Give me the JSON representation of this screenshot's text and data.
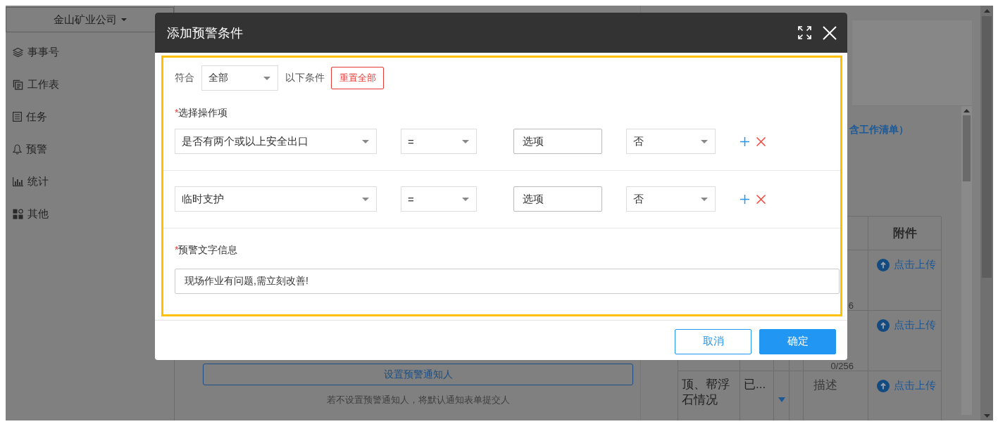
{
  "sidebar": {
    "company": "金山矿业公司",
    "items": [
      {
        "label": "事事号"
      },
      {
        "label": "工作表"
      },
      {
        "label": "任务"
      },
      {
        "label": "预警"
      },
      {
        "label": "统计"
      },
      {
        "label": "其他"
      }
    ]
  },
  "dialog": {
    "title": "添加预警条件",
    "highlighted": true,
    "match": {
      "label": "符合",
      "value": "全部",
      "suffix": "以下条件"
    },
    "reset_button": "重置全部",
    "conditions_label": {
      "mark": "*",
      "text": "选择操作项"
    },
    "conditions": [
      {
        "field": "是否有两个或以上安全出口",
        "operator": "=",
        "value": "选项",
        "answer": "否"
      },
      {
        "field": "临时支护",
        "operator": "=",
        "value": "选项",
        "answer": "否"
      }
    ],
    "message_label": {
      "mark": "*",
      "text": "预警文字信息"
    },
    "message": "现场作业有问题,需立刻改善!",
    "buttons": [
      {
        "label": "取消",
        "kind": "secondary"
      },
      {
        "label": "确定",
        "kind": "primary"
      }
    ]
  },
  "form": {
    "notify_button": "设置预警通知人",
    "hint": "若不设置预警通知人，将默认通知表单提交人"
  },
  "checklist": {
    "title": "含工作清单）",
    "table": {
      "columns": [
        {
          "label": "附件"
        }
      ],
      "rows": [
        {
          "counter": "6",
          "attachment": "点击上传"
        },
        {
          "counter": "0/256",
          "attachment": "点击上传"
        },
        {
          "item": "顶、帮浮石情况",
          "status": "已...",
          "placeholder": "描述",
          "attachment": "点击上传"
        }
      ]
    }
  }
}
